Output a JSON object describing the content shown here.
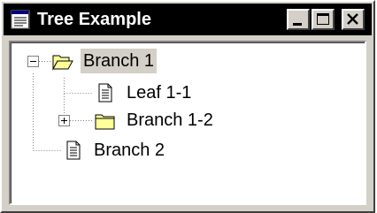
{
  "window": {
    "title": "Tree Example",
    "minimize_icon": "minimize-icon",
    "maximize_icon": "maximize-icon",
    "close_icon": "close-icon"
  },
  "tree": {
    "nodes": [
      {
        "label": "Branch 1",
        "icon": "folder-open-icon",
        "expander": "minus",
        "selected": true
      },
      {
        "label": "Leaf 1-1",
        "icon": "document-icon"
      },
      {
        "label": "Branch 1-2",
        "icon": "folder-closed-icon",
        "expander": "plus"
      },
      {
        "label": "Branch 2",
        "icon": "document-icon"
      }
    ]
  },
  "colors": {
    "titlebar": "#000000",
    "face": "#d4d0c8",
    "folder": "#ffff99",
    "selection": "#d4d0c8"
  }
}
